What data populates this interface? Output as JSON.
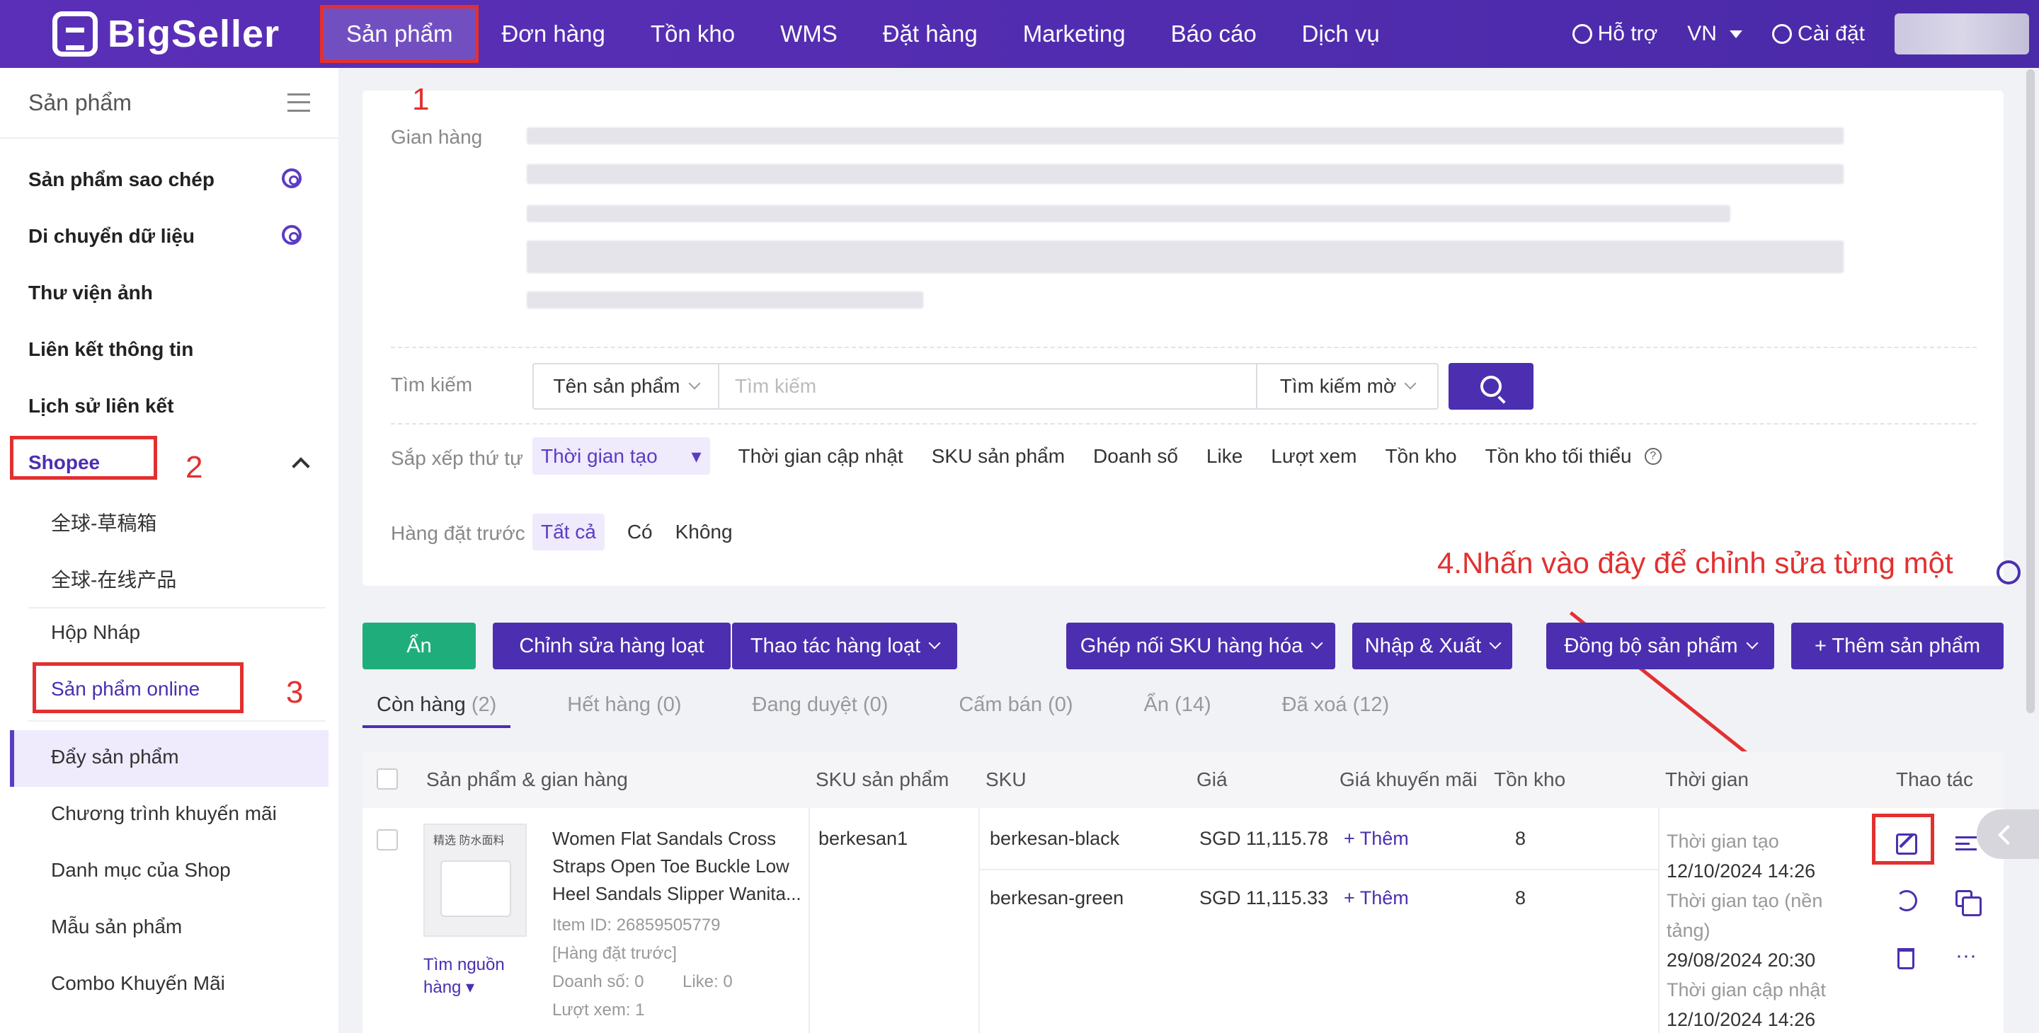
{
  "app": {
    "name": "BigSeller"
  },
  "nav": {
    "items": [
      "Sản phẩm",
      "Đơn hàng",
      "Tồn kho",
      "WMS",
      "Đặt hàng",
      "Marketing",
      "Báo cáo",
      "Dịch vụ"
    ],
    "active": "Sản phẩm"
  },
  "topright": {
    "support": "Hỗ trợ",
    "lang": "VN",
    "settings": "Cài đặt"
  },
  "sidebar": {
    "title": "Sản phẩm",
    "items": [
      "Sản phẩm sao chép",
      "Di chuyển dữ liệu",
      "Thư viện ảnh",
      "Liên kết thông tin",
      "Lịch sử liên kết"
    ],
    "group": "Shopee",
    "subitems": [
      "全球-草稿箱",
      "全球-在线产品",
      "Hộp Nháp",
      "Sản phẩm online"
    ],
    "lower_items": [
      "Đẩy sản phẩm",
      "Chương trình khuyến mãi",
      "Danh mục của Shop",
      "Mẫu sản phẩm",
      "Combo Khuyến Mãi"
    ]
  },
  "annotations": {
    "n1": "1",
    "n2": "2",
    "n3": "3",
    "n4": "4.Nhấn vào đây để chỉnh sửa từng một"
  },
  "filters": {
    "shop_label": "Gian hàng",
    "search_label": "Tìm kiếm",
    "search_field": "Tên sản phẩm",
    "search_placeholder": "Tìm kiếm",
    "search_mode": "Tìm kiếm mờ",
    "sort_label": "Sắp xếp thứ tự",
    "sort_options": [
      "Thời gian tạo",
      "Thời gian cập nhật",
      "SKU sản phẩm",
      "Doanh số",
      "Like",
      "Lượt xem",
      "Tồn kho",
      "Tồn kho tối thiểu"
    ],
    "preorder_label": "Hàng đặt trước",
    "preorder_options": [
      "Tất cả",
      "Có",
      "Không"
    ]
  },
  "actions": {
    "hide": "Ẩn",
    "bulk_edit": "Chỉnh sửa hàng loạt",
    "bulk_ops": "Thao tác hàng loạt",
    "sku_match": "Ghép nối SKU hàng hóa",
    "import_export": "Nhập & Xuất",
    "sync": "Đồng bộ sản phẩm",
    "add": "+ Thêm sản phẩm"
  },
  "tabs": [
    {
      "label": "Còn hàng",
      "count": "(2)"
    },
    {
      "label": "Hết hàng",
      "count": "(0)"
    },
    {
      "label": "Đang duyệt",
      "count": "(0)"
    },
    {
      "label": "Cấm bán",
      "count": "(0)"
    },
    {
      "label": "Ẩn",
      "count": "(14)"
    },
    {
      "label": "Đã xoá",
      "count": "(12)"
    }
  ],
  "table": {
    "headers": [
      "Sản phẩm & gian hàng",
      "SKU sản phẩm",
      "SKU",
      "Giá",
      "Giá khuyến mãi",
      "Tồn kho",
      "Thời gian",
      "Thao tác"
    ],
    "row": {
      "image_tag": "精选 防水面料",
      "find_source": "Tìm nguồn hàng",
      "title_lines": [
        "Women Flat Sandals Cross",
        "Straps Open Toe Buckle Low",
        "Heel Sandals Slipper Wanita..."
      ],
      "item_id": "Item ID: 26859505779",
      "preorder": "[Hàng đặt trước]",
      "sales": "Doanh số: 0",
      "likes": "Like: 0",
      "views": "Lượt xem: 1",
      "product_sku": "berkesan1",
      "variants": [
        {
          "sku": "berkesan-black",
          "price": "SGD 11,115.78",
          "promo": "+ Thêm",
          "stock": "8"
        },
        {
          "sku": "berkesan-green",
          "price": "SGD 11,115.33",
          "promo": "+ Thêm",
          "stock": "8"
        }
      ],
      "times": [
        "Thời gian tạo",
        "12/10/2024 14:26",
        "Thời gian tạo (nền",
        "tảng)",
        "29/08/2024 20:30",
        "Thời gian cập nhật",
        "12/10/2024 14:26"
      ]
    }
  },
  "colors": {
    "primary": "#4b2fb0",
    "accent_red": "#e23030",
    "green": "#1fae7b"
  }
}
